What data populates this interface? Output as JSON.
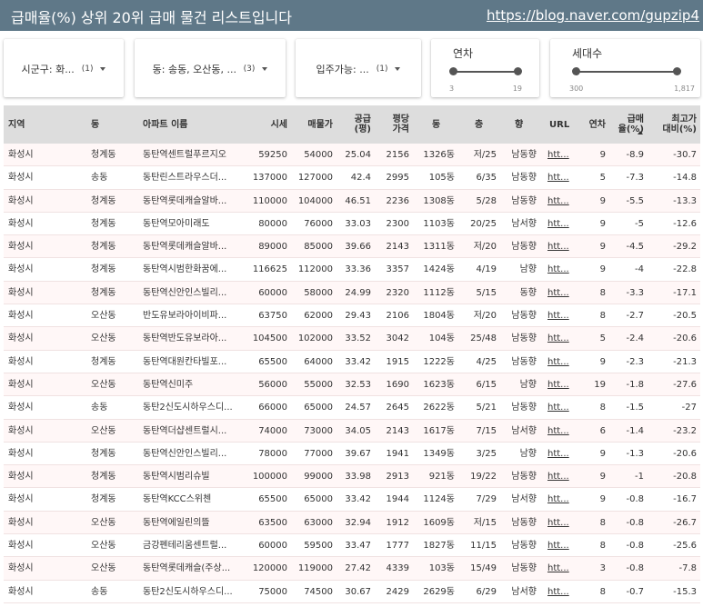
{
  "header": {
    "title": "급매율(%) 상위 20위 급매 물건 리스트입니다",
    "link": "https://blog.naver.com/gupzip4"
  },
  "filters": {
    "region": {
      "label": "시군구: 화...",
      "count": "(1)"
    },
    "dong": {
      "label": "동: 송동, 오산동, ...",
      "count": "(3)"
    },
    "movein": {
      "label": "입주가능: ...",
      "count": "(1)"
    },
    "age": {
      "title": "연차",
      "min": "3",
      "max": "19",
      "low_frac": 0.0,
      "high_frac": 1.0
    },
    "households": {
      "title": "세대수",
      "min": "300",
      "max": "1,817",
      "low_frac": 0.0,
      "high_frac": 1.0
    }
  },
  "table": {
    "headers": {
      "region": "지역",
      "dong": "동",
      "apt": "아파트 이름",
      "price": "시세",
      "sale": "매물가",
      "area": "공급\n(평)",
      "ppp": "평당\n가격",
      "bldg": "동",
      "floor": "층",
      "dir": "향",
      "url": "URL",
      "years": "연차",
      "rate": "급매\n율(%)",
      "maxdiff": "최고가\n대비(%)"
    },
    "rows": [
      [
        "화성시",
        "청계동",
        "동탄역센트럴푸르지오",
        "59250",
        "54000",
        "25.04",
        "2156",
        "1326동",
        "저/25",
        "남동향",
        "htt...",
        "9",
        "-8.9",
        "-30.7"
      ],
      [
        "화성시",
        "송동",
        "동탄린스트라우스더...",
        "137000",
        "127000",
        "42.4",
        "2995",
        "105동",
        "6/35",
        "남동향",
        "htt...",
        "5",
        "-7.3",
        "-14.8"
      ],
      [
        "화성시",
        "청계동",
        "동탄역롯데캐슬알바...",
        "110000",
        "104000",
        "46.51",
        "2236",
        "1308동",
        "5/28",
        "남동향",
        "htt...",
        "9",
        "-5.5",
        "-13.3"
      ],
      [
        "화성시",
        "청계동",
        "동탄역모아미래도",
        "80000",
        "76000",
        "33.03",
        "2300",
        "1103동",
        "20/25",
        "남서향",
        "htt...",
        "9",
        "-5",
        "-12.6"
      ],
      [
        "화성시",
        "청계동",
        "동탄역롯데캐슬알바...",
        "89000",
        "85000",
        "39.66",
        "2143",
        "1311동",
        "저/20",
        "남동향",
        "htt...",
        "9",
        "-4.5",
        "-29.2"
      ],
      [
        "화성시",
        "청계동",
        "동탄역시범한화꿈에...",
        "116625",
        "112000",
        "33.36",
        "3357",
        "1424동",
        "4/19",
        "남향",
        "htt...",
        "9",
        "-4",
        "-22.8"
      ],
      [
        "화성시",
        "청계동",
        "동탄역신안인스빌리...",
        "60000",
        "58000",
        "24.99",
        "2320",
        "1112동",
        "5/15",
        "동향",
        "htt...",
        "8",
        "-3.3",
        "-17.1"
      ],
      [
        "화성시",
        "오산동",
        "반도유보라아이비파...",
        "63750",
        "62000",
        "29.43",
        "2106",
        "1804동",
        "저/20",
        "남동향",
        "htt...",
        "8",
        "-2.7",
        "-20.5"
      ],
      [
        "화성시",
        "오산동",
        "동탄역반도유보라아...",
        "104500",
        "102000",
        "33.52",
        "3042",
        "104동",
        "25/48",
        "남동향",
        "htt...",
        "5",
        "-2.4",
        "-20.6"
      ],
      [
        "화성시",
        "청계동",
        "동탄역대원칸타빌포...",
        "65500",
        "64000",
        "33.42",
        "1915",
        "1222동",
        "4/25",
        "남동향",
        "htt...",
        "9",
        "-2.3",
        "-21.3"
      ],
      [
        "화성시",
        "오산동",
        "동탄역신미주",
        "56000",
        "55000",
        "32.53",
        "1690",
        "1623동",
        "6/15",
        "남향",
        "htt...",
        "19",
        "-1.8",
        "-27.6"
      ],
      [
        "화성시",
        "송동",
        "동탄2신도시하우스디...",
        "66000",
        "65000",
        "24.57",
        "2645",
        "2622동",
        "5/21",
        "남동향",
        "htt...",
        "8",
        "-1.5",
        "-27"
      ],
      [
        "화성시",
        "오산동",
        "동탄역더샵센트럴시...",
        "74000",
        "73000",
        "34.05",
        "2143",
        "1617동",
        "7/15",
        "남서향",
        "htt...",
        "6",
        "-1.4",
        "-23.2"
      ],
      [
        "화성시",
        "청계동",
        "동탄역신안인스빌리...",
        "78000",
        "77000",
        "39.67",
        "1941",
        "1349동",
        "3/25",
        "남향",
        "htt...",
        "9",
        "-1.3",
        "-20.6"
      ],
      [
        "화성시",
        "청계동",
        "동탄역시범리슈빌",
        "100000",
        "99000",
        "33.98",
        "2913",
        "921동",
        "19/22",
        "남동향",
        "htt...",
        "9",
        "-1",
        "-20.8"
      ],
      [
        "화성시",
        "청계동",
        "동탄역KCC스위첸",
        "65500",
        "65000",
        "33.42",
        "1944",
        "1124동",
        "7/29",
        "남서향",
        "htt...",
        "9",
        "-0.8",
        "-16.7"
      ],
      [
        "화성시",
        "오산동",
        "동탄역에일린의뜰",
        "63500",
        "63000",
        "32.94",
        "1912",
        "1609동",
        "저/15",
        "남동향",
        "htt...",
        "8",
        "-0.8",
        "-26.7"
      ],
      [
        "화성시",
        "오산동",
        "금강펜테리움센트럴...",
        "60000",
        "59500",
        "33.47",
        "1777",
        "1827동",
        "11/15",
        "남동향",
        "htt...",
        "8",
        "-0.8",
        "-25.6"
      ],
      [
        "화성시",
        "오산동",
        "동탄역롯데캐슬(주상...",
        "120000",
        "119000",
        "27.42",
        "4339",
        "103동",
        "15/49",
        "남동향",
        "htt...",
        "3",
        "-0.8",
        "-7.8"
      ],
      [
        "화성시",
        "송동",
        "동탄2신도시하우스디...",
        "75000",
        "74500",
        "30.67",
        "2429",
        "2629동",
        "6/29",
        "남서향",
        "htt...",
        "8",
        "-0.7",
        "-15.3"
      ]
    ]
  }
}
